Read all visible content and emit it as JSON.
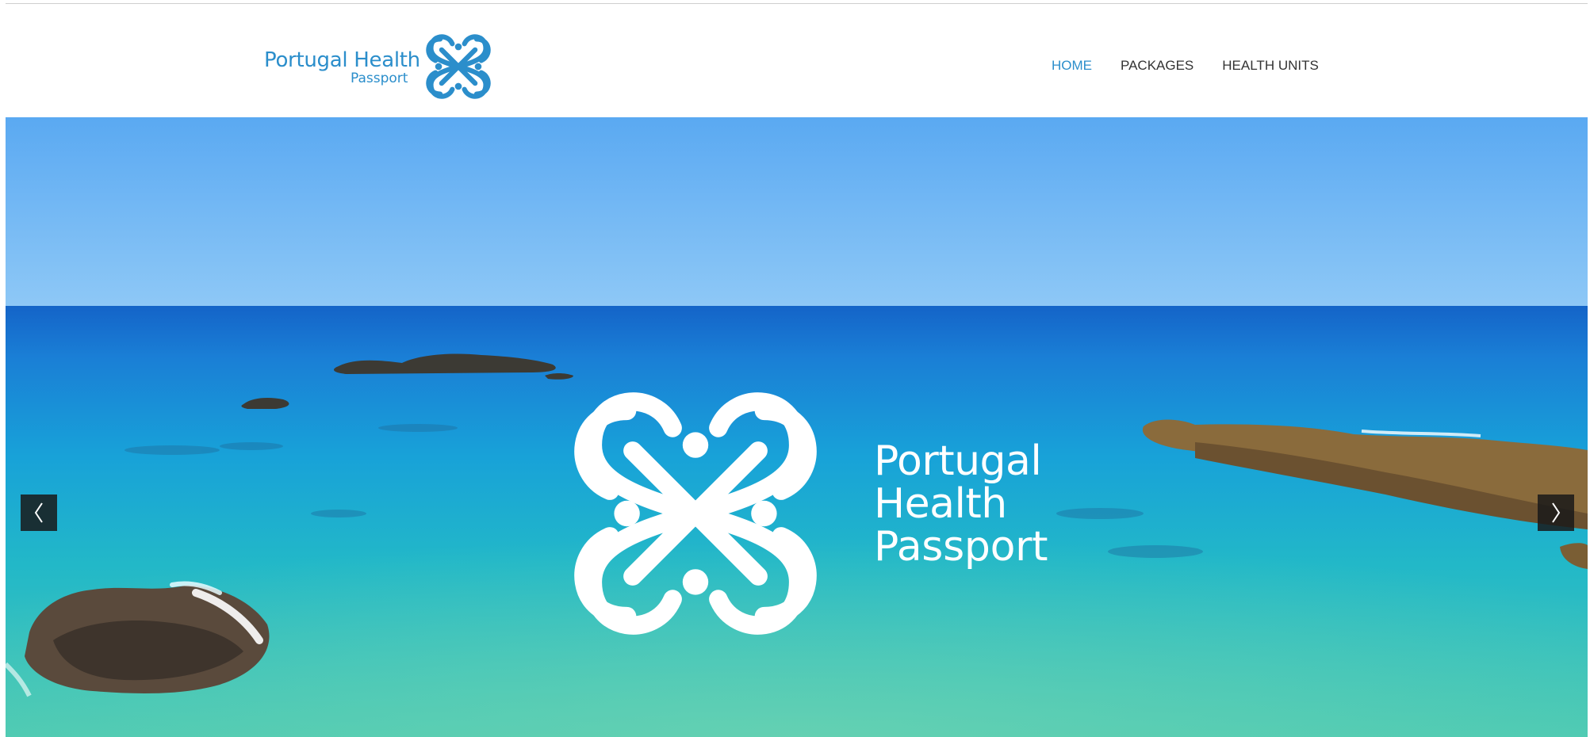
{
  "brand": {
    "name": "Portugal Health",
    "sub": "Passport"
  },
  "nav": {
    "items": [
      {
        "label": "HOME",
        "active": true
      },
      {
        "label": "PACKAGES",
        "active": false
      },
      {
        "label": "HEALTH UNITS",
        "active": false
      }
    ]
  },
  "slider": {
    "title_line1": "Portugal",
    "title_line2": "Health",
    "title_line3": "Passport",
    "prev_icon": "chevron-left-icon",
    "next_icon": "chevron-right-icon"
  },
  "colors": {
    "brand_blue": "#2b8ecb",
    "nav_text": "#333333",
    "sky": "#4ea3ef",
    "sea": "#23b7c4"
  }
}
